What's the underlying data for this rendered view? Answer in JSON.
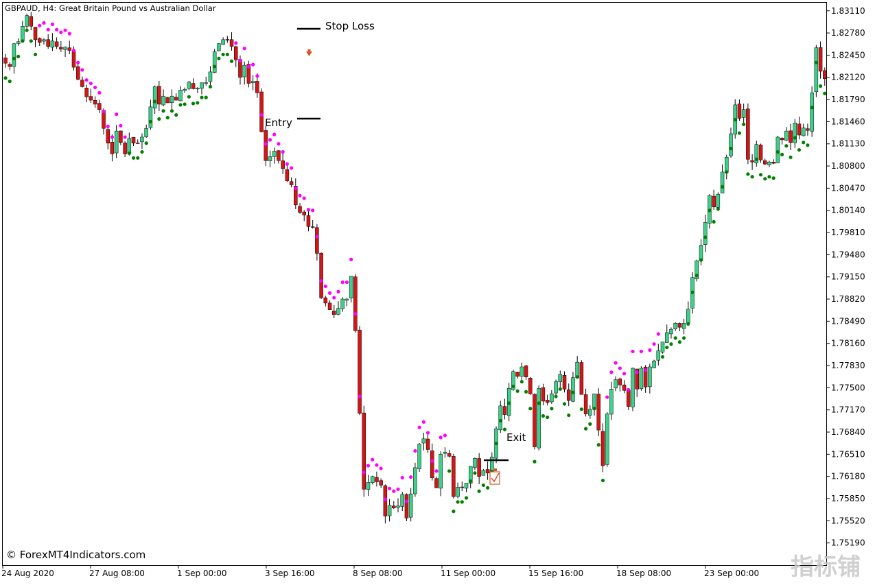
{
  "header": {
    "symbol_text": "GBPAUD, H4:  Great Britain Pound vs Australian Dollar"
  },
  "watermark": {
    "copyright": "© ForexMT4Indicators.com",
    "logo_text": "指标铺"
  },
  "annotations": {
    "stop_loss": "Stop Loss",
    "entry": "Entry",
    "exit": "Exit"
  },
  "colors": {
    "bull": "#3cd08a",
    "bear": "#d41515",
    "wick": "#000000",
    "psar_up": "#008000",
    "psar_down": "#ff00ff",
    "axis": "#000000",
    "marker": "#d9542b"
  },
  "chart_data": {
    "type": "candlestick",
    "title": "GBPAUD, H4:  Great Britain Pound vs Australian Dollar",
    "xlabel": "",
    "ylabel": "",
    "ylim": [
      1.7486,
      1.8323
    ],
    "y_ticks": [
      "1.83110",
      "1.82780",
      "1.82450",
      "1.82120",
      "1.81790",
      "1.81460",
      "1.81130",
      "1.80800",
      "1.80470",
      "1.80140",
      "1.79810",
      "1.79480",
      "1.79150",
      "1.78820",
      "1.78490",
      "1.78160",
      "1.77830",
      "1.77500",
      "1.77170",
      "1.76840",
      "1.76510",
      "1.76180",
      "1.75850",
      "1.75520",
      "1.75190"
    ],
    "x_ticks": [
      "24 Aug 2020",
      "27 Aug 08:00",
      "1 Sep 00:00",
      "3 Sep 16:00",
      "8 Sep 08:00",
      "11 Sep 00:00",
      "15 Sep 16:00",
      "18 Sep 08:00",
      "23 Sep 00:00"
    ],
    "candle_closes": [
      1.8233,
      1.8228,
      1.8262,
      1.8265,
      1.8288,
      1.8304,
      1.8288,
      1.8268,
      1.8264,
      1.8268,
      1.8258,
      1.8266,
      1.8258,
      1.8254,
      1.8257,
      1.8252,
      1.8227,
      1.8209,
      1.8198,
      1.8183,
      1.8178,
      1.8172,
      1.8164,
      1.8136,
      1.8114,
      1.8098,
      1.8132,
      1.8115,
      1.8098,
      1.8121,
      1.8114,
      1.8114,
      1.8123,
      1.8136,
      1.8168,
      1.8198,
      1.8172,
      1.8184,
      1.8174,
      1.8184,
      1.8178,
      1.8193,
      1.8194,
      1.8205,
      1.8195,
      1.8196,
      1.8204,
      1.8204,
      1.822,
      1.825,
      1.8262,
      1.8268,
      1.8268,
      1.8258,
      1.8238,
      1.8212,
      1.823,
      1.8203,
      1.8206,
      1.8189,
      1.8131,
      1.8088,
      1.8094,
      1.8102,
      1.8088,
      1.8076,
      1.8058,
      1.8052,
      1.8022,
      1.8011,
      1.8007,
      1.799,
      1.7989,
      1.795,
      1.7884,
      1.7876,
      1.7866,
      1.7859,
      1.7868,
      1.7882,
      1.7882,
      1.7916,
      1.7835,
      1.7712,
      1.7599,
      1.7609,
      1.7618,
      1.761,
      1.7605,
      1.7559,
      1.7575,
      1.7571,
      1.7574,
      1.7591,
      1.7556,
      1.7592,
      1.7631,
      1.7666,
      1.7674,
      1.7658,
      1.7616,
      1.7601,
      1.7651,
      1.7654,
      1.7648,
      1.7588,
      1.7602,
      1.7602,
      1.7608,
      1.7633,
      1.7645,
      1.7618,
      1.7627,
      1.7623,
      1.7647,
      1.7689,
      1.7723,
      1.771,
      1.7749,
      1.7774,
      1.7767,
      1.7781,
      1.7766,
      1.7741,
      1.7662,
      1.7749,
      1.773,
      1.7728,
      1.7741,
      1.7759,
      1.777,
      1.7748,
      1.7731,
      1.7765,
      1.7788,
      1.774,
      1.7711,
      1.7718,
      1.7741,
      1.7687,
      1.7634,
      1.7711,
      1.7748,
      1.7762,
      1.7754,
      1.7746,
      1.7722,
      1.7779,
      1.7748,
      1.7779,
      1.7751,
      1.7781,
      1.779,
      1.7805,
      1.7818,
      1.7832,
      1.7837,
      1.7846,
      1.784,
      1.7846,
      1.7867,
      1.7914,
      1.7939,
      1.7962,
      1.7996,
      1.8036,
      1.8019,
      1.8038,
      1.8071,
      1.8093,
      1.8128,
      1.8171,
      1.8151,
      1.8164,
      1.809,
      1.8086,
      1.8112,
      1.8089,
      1.8083,
      1.8086,
      1.8084,
      1.8123,
      1.8119,
      1.8132,
      1.8115,
      1.8144,
      1.8126,
      1.8137,
      1.8133,
      1.8189,
      1.8256,
      1.8221,
      1.821
    ],
    "psar": [
      {
        "phase": "up_then_down",
        "note": "approx. values per bar"
      }
    ],
    "annotations": [
      "Stop Loss",
      "Entry",
      "Exit"
    ]
  }
}
